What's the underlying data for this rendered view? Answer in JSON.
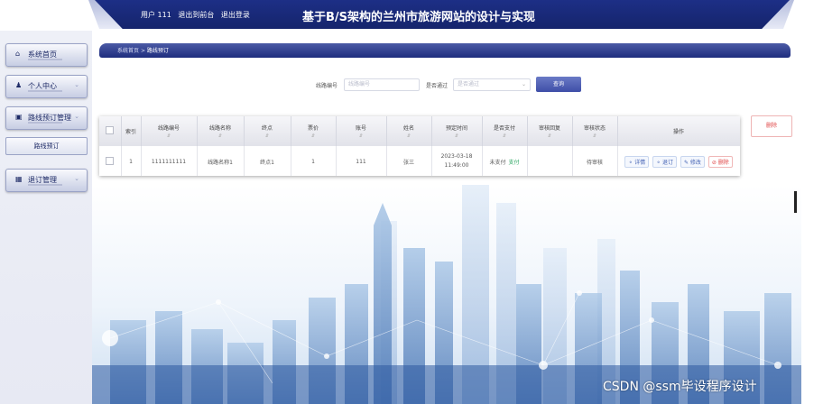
{
  "header": {
    "user_label": "用户 111",
    "back_to_front": "退出到前台",
    "logout": "退出登录",
    "site_title": "基于B/S架构的兰州市旅游网站的设计与实现"
  },
  "sidebar": {
    "items": [
      {
        "label": "系统首页",
        "icon": "home-icon"
      },
      {
        "label": "个人中心",
        "icon": "person-icon"
      },
      {
        "label": "路线预订管理",
        "icon": "monitor-icon"
      },
      {
        "label": "退订管理",
        "icon": "grid-icon"
      }
    ],
    "subitem": "路线预订"
  },
  "breadcrumb": {
    "home": "系统首页",
    "sep": ">",
    "current": "路线预订"
  },
  "search": {
    "route_no_label": "线路编号",
    "route_no_placeholder": "线路编号",
    "is_approved_label": "是否通过",
    "is_approved_placeholder": "是否通过",
    "query_button": "查询"
  },
  "toolbar": {
    "delete_button": "删除"
  },
  "table": {
    "headers": [
      "",
      "索引",
      "线路编号",
      "线路名称",
      "终点",
      "票价",
      "账号",
      "姓名",
      "预定时间",
      "是否支付",
      "审核回复",
      "审核状态",
      "操作"
    ],
    "rows": [
      {
        "index": "1",
        "route_no": "1111111111",
        "route_name": "线路名称1",
        "destination": "终点1",
        "price": "1",
        "account": "111",
        "name": "张三",
        "booking_time": "2023-03-18 11:49:00",
        "paid_status": "未支付",
        "pay_link": "支付",
        "review_reply": "",
        "review_status": "待审核",
        "actions": [
          "详情",
          "退订",
          "修改",
          "删除"
        ]
      }
    ]
  },
  "watermark": "CSDN @ssm毕设程序设计",
  "colors": {
    "navy": "#1d2f86",
    "accent": "#3e4ea7",
    "danger": "#e04848",
    "success": "#28a55f"
  }
}
